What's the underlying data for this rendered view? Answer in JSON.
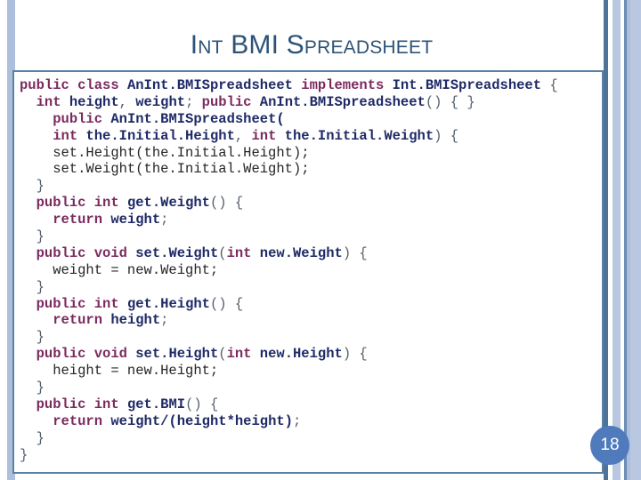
{
  "slide": {
    "page_number": "18",
    "accent_color": "#2d5376",
    "badge_color": "#4f7bbd",
    "code_border_color": "#5b80a6",
    "stripe_color": "#aebfdb"
  },
  "title": {
    "text": "Int BMI Spreadsheet"
  },
  "code": {
    "language": "java",
    "lines": [
      [
        {
          "t": "public ",
          "c": "kw"
        },
        {
          "t": "class ",
          "c": "kw"
        },
        {
          "t": "AnInt.BMISpreadsheet ",
          "c": "id"
        },
        {
          "t": "implements ",
          "c": "kw"
        },
        {
          "t": "Int.BMISpreadsheet ",
          "c": "id"
        },
        {
          "t": "{",
          "c": "br"
        }
      ],
      [
        {
          "t": "  ",
          "c": "pl"
        },
        {
          "t": "int ",
          "c": "kw"
        },
        {
          "t": "height",
          "c": "id"
        },
        {
          "t": ", ",
          "c": "br"
        },
        {
          "t": "weight",
          "c": "id"
        },
        {
          "t": "; ",
          "c": "br"
        },
        {
          "t": "public ",
          "c": "kw"
        },
        {
          "t": "AnInt.BMISpreadsheet",
          "c": "id"
        },
        {
          "t": "() { }",
          "c": "br"
        }
      ],
      [
        {
          "t": "    ",
          "c": "pl"
        },
        {
          "t": "public ",
          "c": "kw"
        },
        {
          "t": "AnInt.BMISpreadsheet(",
          "c": "id"
        }
      ],
      [
        {
          "t": "    ",
          "c": "pl"
        },
        {
          "t": "int ",
          "c": "kw"
        },
        {
          "t": "the.Initial.Height",
          "c": "id"
        },
        {
          "t": ", ",
          "c": "br"
        },
        {
          "t": "int ",
          "c": "kw"
        },
        {
          "t": "the.Initial.Weight",
          "c": "id"
        },
        {
          "t": ") {",
          "c": "br"
        }
      ],
      [
        {
          "t": "    set.Height(the.Initial.Height);",
          "c": "pl"
        }
      ],
      [
        {
          "t": "    set.Weight(the.Initial.Weight);",
          "c": "pl"
        }
      ],
      [
        {
          "t": "  }",
          "c": "br"
        }
      ],
      [
        {
          "t": "  ",
          "c": "pl"
        },
        {
          "t": "public ",
          "c": "kw"
        },
        {
          "t": "int ",
          "c": "kw"
        },
        {
          "t": "get.Weight",
          "c": "id"
        },
        {
          "t": "() {",
          "c": "br"
        }
      ],
      [
        {
          "t": "    ",
          "c": "pl"
        },
        {
          "t": "return ",
          "c": "kw"
        },
        {
          "t": "weight",
          "c": "id"
        },
        {
          "t": ";",
          "c": "br"
        }
      ],
      [
        {
          "t": "  }",
          "c": "br"
        }
      ],
      [
        {
          "t": "  ",
          "c": "pl"
        },
        {
          "t": "public ",
          "c": "kw"
        },
        {
          "t": "void ",
          "c": "kw"
        },
        {
          "t": "set.Weight",
          "c": "id"
        },
        {
          "t": "(",
          "c": "br"
        },
        {
          "t": "int ",
          "c": "kw"
        },
        {
          "t": "new.Weight",
          "c": "id"
        },
        {
          "t": ") {",
          "c": "br"
        }
      ],
      [
        {
          "t": "    weight = new.Weight;",
          "c": "pl"
        }
      ],
      [
        {
          "t": "  }",
          "c": "br"
        }
      ],
      [
        {
          "t": "  ",
          "c": "pl"
        },
        {
          "t": "public ",
          "c": "kw"
        },
        {
          "t": "int ",
          "c": "kw"
        },
        {
          "t": "get.Height",
          "c": "id"
        },
        {
          "t": "() {",
          "c": "br"
        }
      ],
      [
        {
          "t": "    ",
          "c": "pl"
        },
        {
          "t": "return ",
          "c": "kw"
        },
        {
          "t": "height",
          "c": "id"
        },
        {
          "t": ";",
          "c": "br"
        }
      ],
      [
        {
          "t": "  }",
          "c": "br"
        }
      ],
      [
        {
          "t": "  ",
          "c": "pl"
        },
        {
          "t": "public ",
          "c": "kw"
        },
        {
          "t": "void ",
          "c": "kw"
        },
        {
          "t": "set.Height",
          "c": "id"
        },
        {
          "t": "(",
          "c": "br"
        },
        {
          "t": "int ",
          "c": "kw"
        },
        {
          "t": "new.Height",
          "c": "id"
        },
        {
          "t": ") {",
          "c": "br"
        }
      ],
      [
        {
          "t": "    height = new.Height;",
          "c": "pl"
        }
      ],
      [
        {
          "t": "  }",
          "c": "br"
        }
      ],
      [
        {
          "t": "  ",
          "c": "pl"
        },
        {
          "t": "public ",
          "c": "kw"
        },
        {
          "t": "int ",
          "c": "kw"
        },
        {
          "t": "get.BMI",
          "c": "id"
        },
        {
          "t": "() {",
          "c": "br"
        }
      ],
      [
        {
          "t": "    ",
          "c": "pl"
        },
        {
          "t": "return ",
          "c": "kw"
        },
        {
          "t": "weight/(height*height)",
          "c": "id"
        },
        {
          "t": ";",
          "c": "br"
        }
      ],
      [
        {
          "t": "  }",
          "c": "br"
        }
      ],
      [
        {
          "t": "}",
          "c": "br"
        }
      ]
    ]
  }
}
